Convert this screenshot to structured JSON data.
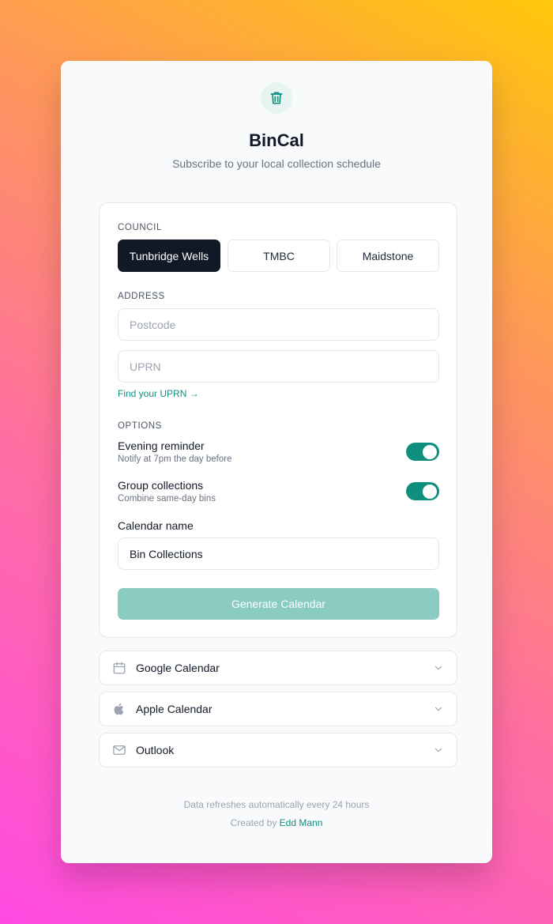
{
  "header": {
    "title": "BinCal",
    "subtitle": "Subscribe to your local collection schedule",
    "logo_icon": "trash-icon"
  },
  "council": {
    "label": "COUNCIL",
    "options": [
      "Tunbridge Wells",
      "TMBC",
      "Maidstone"
    ],
    "selected": "Tunbridge Wells"
  },
  "address": {
    "label": "ADDRESS",
    "postcode_placeholder": "Postcode",
    "postcode_value": "",
    "uprn_placeholder": "UPRN",
    "uprn_value": "",
    "find_uprn_link": "Find your UPRN →"
  },
  "options": {
    "label": "OPTIONS",
    "items": [
      {
        "title": "Evening reminder",
        "description": "Notify at 7pm the day before",
        "enabled": true
      },
      {
        "title": "Group collections",
        "description": "Combine same-day bins",
        "enabled": true
      }
    ]
  },
  "calendar_name": {
    "label": "Calendar name",
    "value": "Bin Collections"
  },
  "generate_button": "Generate Calendar",
  "integrations": [
    {
      "label": "Google Calendar",
      "icon": "calendar-icon"
    },
    {
      "label": "Apple Calendar",
      "icon": "apple-icon"
    },
    {
      "label": "Outlook",
      "icon": "mail-icon"
    }
  ],
  "footer": {
    "refresh_note": "Data refreshes automatically every 24 hours",
    "created_by": "Created by",
    "author": "Edd Mann"
  },
  "colors": {
    "accent": "#0f8f7e",
    "selected_council_bg": "#111827",
    "generate_button_bg": "#8acbc2"
  }
}
